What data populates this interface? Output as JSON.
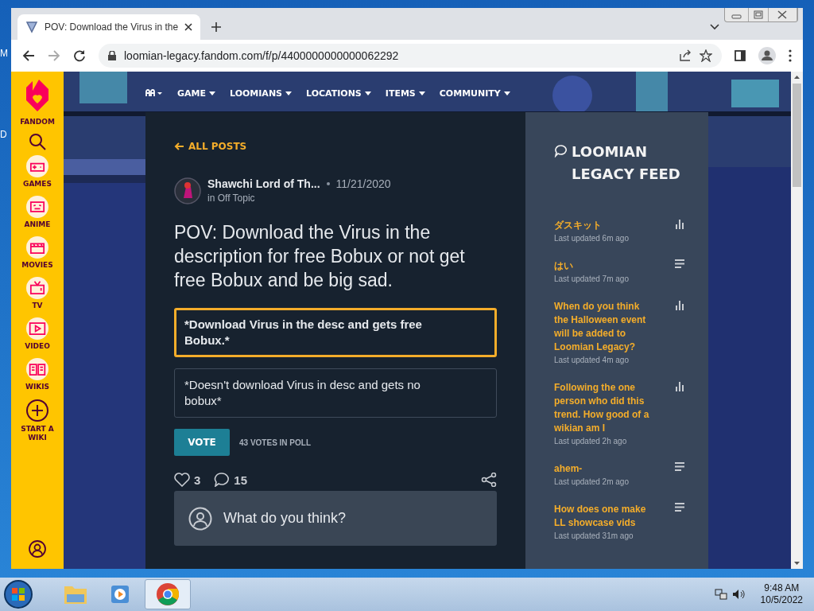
{
  "desktop_labels": [
    "M",
    "D"
  ],
  "browser": {
    "tab_title": "POV: Download the Virus in the",
    "url": "loomian-legacy.fandom.com/f/p/4400000000000062292"
  },
  "rail": {
    "brand": "FANDOM",
    "items": [
      {
        "label": "GAMES",
        "kind": "games"
      },
      {
        "label": "ANIME",
        "kind": "anime"
      },
      {
        "label": "MOVIES",
        "kind": "movies"
      },
      {
        "label": "TV",
        "kind": "tv"
      },
      {
        "label": "VIDEO",
        "kind": "video"
      },
      {
        "label": "WIKIS",
        "kind": "wikis"
      },
      {
        "label": "START A WIKI",
        "kind": "add"
      }
    ]
  },
  "nav": [
    "GAME",
    "LOOMIANS",
    "LOCATIONS",
    "ITEMS",
    "COMMUNITY"
  ],
  "post": {
    "back": "ALL POSTS",
    "author": "Shawchi Lord of Th...",
    "date": "11/21/2020",
    "category": "in Off Topic",
    "title": "POV: Download the Virus in the description for free Bobux or not get free Bobux and be big sad.",
    "poll": {
      "options": [
        {
          "text": "*Download Virus in the desc and gets free Bobux.*",
          "selected": true
        },
        {
          "text": "*Doesn't download Virus in desc and gets no bobux*",
          "selected": false
        }
      ],
      "vote_button": "VOTE",
      "votes": "43 VOTES IN POLL"
    },
    "likes": "3",
    "comments": "15",
    "comment_placeholder": "What do you think?"
  },
  "feed": {
    "title": "LOOMIAN LEGACY FEED",
    "items": [
      {
        "title": "ダスキット",
        "updated": "Last updated 6m ago",
        "kind": "poll"
      },
      {
        "title": "はい",
        "updated": "Last updated 7m ago",
        "kind": "text"
      },
      {
        "title": "When do you think the Halloween event will be added to Loomian Legacy?",
        "updated": "Last updated 4m ago",
        "kind": "poll"
      },
      {
        "title": "Following the one person who did this trend. How good of a wikian am I",
        "updated": "Last updated 2h ago",
        "kind": "poll"
      },
      {
        "title": "ahem-",
        "updated": "Last updated 2m ago",
        "kind": "text"
      },
      {
        "title": "How does one make LL showcase vids",
        "updated": "Last updated 31m ago",
        "kind": "text"
      }
    ]
  },
  "taskbar": {
    "apps": [
      {
        "kind": "folder",
        "selected": false
      },
      {
        "kind": "media",
        "selected": false
      },
      {
        "kind": "chrome",
        "selected": true
      }
    ],
    "time": "9:48 AM",
    "date": "10/5/2022"
  }
}
